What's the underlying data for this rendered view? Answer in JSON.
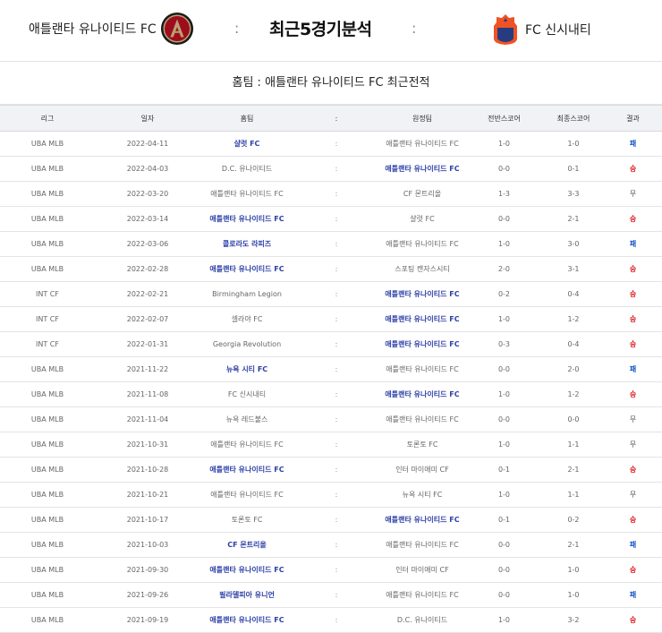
{
  "header": {
    "home_team": "애틀랜타 유나이티드 FC",
    "title": "최근5경기분석",
    "separator": ":",
    "away_team": "FC 신시내티"
  },
  "subtitle": "홈팀 : 애틀랜타 유나이티드 FC 최근전적",
  "columns": [
    "리그",
    "일자",
    "홈팀",
    ":",
    "원정팀",
    "전반스코어",
    "최종스코어",
    "결과"
  ],
  "colors": {
    "team_highlight": "#2c3fa6",
    "win": "#d9171e",
    "loss": "#1a56c9"
  },
  "rows": [
    {
      "league": "UBA MLB",
      "date": "2022-04-11",
      "home": "샬럿 FC",
      "home_hl": true,
      "away": "애틀랜타 유나이티드 FC",
      "away_hl": false,
      "half": "1-0",
      "final": "1-0",
      "result": "패",
      "result_type": "loss"
    },
    {
      "league": "UBA MLB",
      "date": "2022-04-03",
      "home": "D.C. 유나이티드",
      "home_hl": false,
      "away": "애틀랜타 유나이티드 FC",
      "away_hl": true,
      "half": "0-0",
      "final": "0-1",
      "result": "승",
      "result_type": "win"
    },
    {
      "league": "UBA MLB",
      "date": "2022-03-20",
      "home": "애틀랜타 유나이티드 FC",
      "home_hl": false,
      "away": "CF 몬트리올",
      "away_hl": false,
      "half": "1-3",
      "final": "3-3",
      "result": "무",
      "result_type": "draw"
    },
    {
      "league": "UBA MLB",
      "date": "2022-03-14",
      "home": "애틀랜타 유나이티드 FC",
      "home_hl": true,
      "away": "샬럿 FC",
      "away_hl": false,
      "half": "0-0",
      "final": "2-1",
      "result": "승",
      "result_type": "win"
    },
    {
      "league": "UBA MLB",
      "date": "2022-03-06",
      "home": "콜로라도 라피즈",
      "home_hl": true,
      "away": "애틀랜타 유나이티드 FC",
      "away_hl": false,
      "half": "1-0",
      "final": "3-0",
      "result": "패",
      "result_type": "loss"
    },
    {
      "league": "UBA MLB",
      "date": "2022-02-28",
      "home": "애틀랜타 유나이티드 FC",
      "home_hl": true,
      "away": "스포팅 캔자스시티",
      "away_hl": false,
      "half": "2-0",
      "final": "3-1",
      "result": "승",
      "result_type": "win"
    },
    {
      "league": "INT CF",
      "date": "2022-02-21",
      "home": "Birmingham Legion",
      "home_hl": false,
      "away": "애틀랜타 유나이티드 FC",
      "away_hl": true,
      "half": "0-2",
      "final": "0-4",
      "result": "승",
      "result_type": "win"
    },
    {
      "league": "INT CF",
      "date": "2022-02-07",
      "home": "셀라야 FC",
      "home_hl": false,
      "away": "애틀랜타 유나이티드 FC",
      "away_hl": true,
      "half": "1-0",
      "final": "1-2",
      "result": "승",
      "result_type": "win"
    },
    {
      "league": "INT CF",
      "date": "2022-01-31",
      "home": "Georgia Revolution",
      "home_hl": false,
      "away": "애틀랜타 유나이티드 FC",
      "away_hl": true,
      "half": "0-3",
      "final": "0-4",
      "result": "승",
      "result_type": "win"
    },
    {
      "league": "UBA MLB",
      "date": "2021-11-22",
      "home": "뉴욕 시티 FC",
      "home_hl": true,
      "away": "애틀랜타 유나이티드 FC",
      "away_hl": false,
      "half": "0-0",
      "final": "2-0",
      "result": "패",
      "result_type": "loss"
    },
    {
      "league": "UBA MLB",
      "date": "2021-11-08",
      "home": "FC 신시내티",
      "home_hl": false,
      "away": "애틀랜타 유나이티드 FC",
      "away_hl": true,
      "half": "1-0",
      "final": "1-2",
      "result": "승",
      "result_type": "win"
    },
    {
      "league": "UBA MLB",
      "date": "2021-11-04",
      "home": "뉴욕 레드불스",
      "home_hl": false,
      "away": "애틀랜타 유나이티드 FC",
      "away_hl": false,
      "half": "0-0",
      "final": "0-0",
      "result": "무",
      "result_type": "draw"
    },
    {
      "league": "UBA MLB",
      "date": "2021-10-31",
      "home": "애틀랜타 유나이티드 FC",
      "home_hl": false,
      "away": "토론토 FC",
      "away_hl": false,
      "half": "1-0",
      "final": "1-1",
      "result": "무",
      "result_type": "draw"
    },
    {
      "league": "UBA MLB",
      "date": "2021-10-28",
      "home": "애틀랜타 유나이티드 FC",
      "home_hl": true,
      "away": "인터 마이애미 CF",
      "away_hl": false,
      "half": "0-1",
      "final": "2-1",
      "result": "승",
      "result_type": "win"
    },
    {
      "league": "UBA MLB",
      "date": "2021-10-21",
      "home": "애틀랜타 유나이티드 FC",
      "home_hl": false,
      "away": "뉴욕 시티 FC",
      "away_hl": false,
      "half": "1-0",
      "final": "1-1",
      "result": "무",
      "result_type": "draw"
    },
    {
      "league": "UBA MLB",
      "date": "2021-10-17",
      "home": "토론토 FC",
      "home_hl": false,
      "away": "애틀랜타 유나이티드 FC",
      "away_hl": true,
      "half": "0-1",
      "final": "0-2",
      "result": "승",
      "result_type": "win"
    },
    {
      "league": "UBA MLB",
      "date": "2021-10-03",
      "home": "CF 몬트리올",
      "home_hl": true,
      "away": "애틀랜타 유나이티드 FC",
      "away_hl": false,
      "half": "0-0",
      "final": "2-1",
      "result": "패",
      "result_type": "loss"
    },
    {
      "league": "UBA MLB",
      "date": "2021-09-30",
      "home": "애틀랜타 유나이티드 FC",
      "home_hl": true,
      "away": "인터 마이애미 CF",
      "away_hl": false,
      "half": "0-0",
      "final": "1-0",
      "result": "승",
      "result_type": "win"
    },
    {
      "league": "UBA MLB",
      "date": "2021-09-26",
      "home": "필라델피아 유니언",
      "home_hl": true,
      "away": "애틀랜타 유나이티드 FC",
      "away_hl": false,
      "half": "0-0",
      "final": "1-0",
      "result": "패",
      "result_type": "loss"
    },
    {
      "league": "UBA MLB",
      "date": "2021-09-19",
      "home": "애틀랜타 유나이티드 FC",
      "home_hl": true,
      "away": "D.C. 유나이티드",
      "away_hl": false,
      "half": "1-0",
      "final": "3-2",
      "result": "승",
      "result_type": "win"
    }
  ]
}
